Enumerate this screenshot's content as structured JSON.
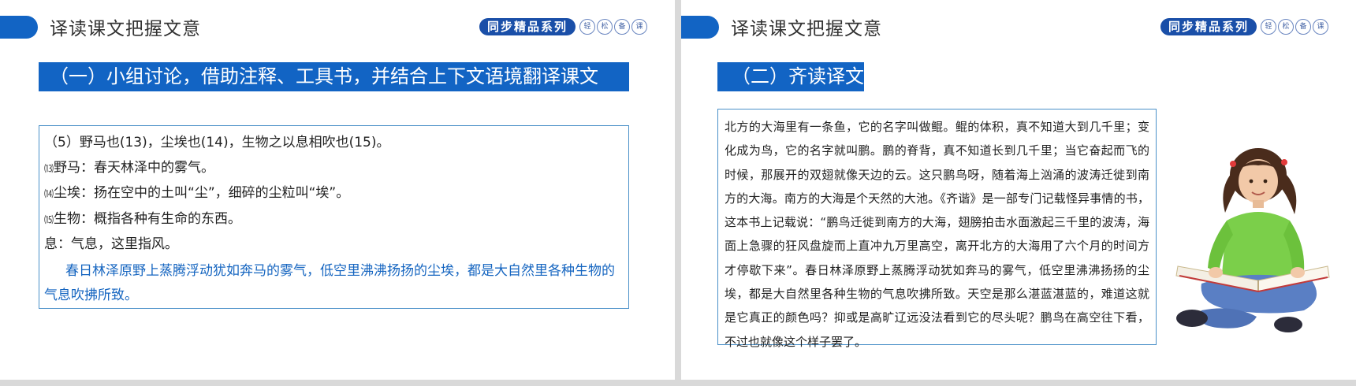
{
  "left_slide": {
    "title": "译读课文把握文意",
    "series": {
      "main": "同步精品系列",
      "dots": [
        "轻",
        "松",
        "备",
        "课"
      ]
    },
    "band": "（一）小组讨论，借助注释、工具书，并结合上下文语境翻译课文",
    "lines": [
      {
        "text": "（5）野马也(13)，尘埃也(14)，生物之以息相吹也(15)。"
      },
      {
        "num": "⒀",
        "text": "野马：春天林泽中的雾气。"
      },
      {
        "num": "⒁",
        "text": "尘埃：扬在空中的土叫“尘”，细碎的尘粒叫“埃”。"
      },
      {
        "num": "⒂",
        "text": "生物：概指各种有生命的东西。"
      },
      {
        "text": "息：气息，这里指风。"
      }
    ],
    "translation": "春日林泽原野上蒸腾浮动犹如奔马的雾气，低空里沸沸扬扬的尘埃，都是大自然里各种生物的气息吹拂所致。"
  },
  "right_slide": {
    "title": "译读课文把握文意",
    "series": {
      "main": "同步精品系列",
      "dots": [
        "轻",
        "松",
        "备",
        "课"
      ]
    },
    "band": "（二）齐读译文",
    "paragraph": "北方的大海里有一条鱼，它的名字叫做鲲。鲲的体积，真不知道大到几千里；变化成为鸟，它的名字就叫鹏。鹏的脊背，真不知道长到几千里；当它奋起而飞的时候，那展开的双翅就像天边的云。这只鹏鸟呀，随着海上汹涌的波涛迁徙到南方的大海。南方的大海是个天然的大池。《齐谐》是一部专门记载怪异事情的书，这本书上记载说：“鹏鸟迁徙到南方的大海，翅膀拍击水面激起三千里的波涛，海面上急骤的狂风盘旋而上直冲九万里高空，离开北方的大海用了六个月的时间方才停歇下来”。春日林泽原野上蒸腾浮动犹如奔马的雾气，低空里沸沸扬扬的尘埃，都是大自然里各种生物的气息吹拂所致。天空是那么湛蓝湛蓝的，难道这就是它真正的颜色吗？抑或是高旷辽远没法看到它的尽头呢？鹏鸟在高空往下看，不过也就像这个样子罢了。"
  },
  "colors": {
    "accent": "#1264c4",
    "badge": "#1a4fa8",
    "translation": "#1565c0",
    "border": "#4a90c8"
  }
}
